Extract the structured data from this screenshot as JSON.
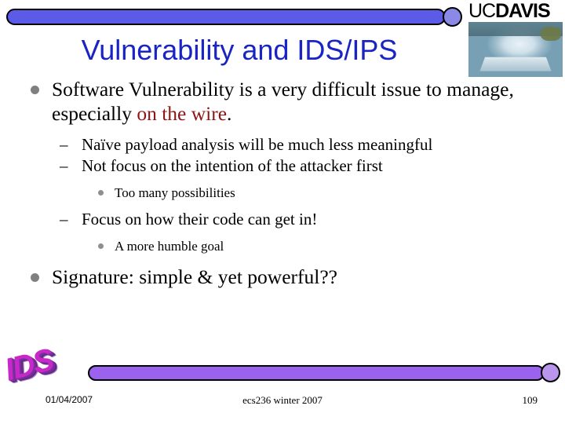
{
  "slide": {
    "title": "Vulnerability and IDS/IPS",
    "bullets": [
      {
        "level": 1,
        "text_before": "Software Vulnerability is a very difficult issue to manage, especially ",
        "highlight": "on the wire",
        "text_after": "."
      },
      {
        "level": 2,
        "marker": "–",
        "text": "Naïve payload analysis will be much less meaningful"
      },
      {
        "level": 2,
        "marker": "–",
        "text": "Not focus on the intention of the attacker first"
      },
      {
        "level": 3,
        "text": "Too many possibilities"
      },
      {
        "level": 2,
        "marker": "–",
        "text": "Focus on how their code can get in!"
      },
      {
        "level": 3,
        "text": "A more humble goal"
      },
      {
        "level": 1,
        "text": "Signature: simple & yet powerful??"
      }
    ]
  },
  "branding": {
    "wordmark_uc": "UC",
    "wordmark_davis": "DAVIS",
    "photo_alt": "egghead-sculpture-photo",
    "ids_logo_text": "IDS"
  },
  "footer": {
    "date": "01/04/2007",
    "course": "ecs236 winter 2007",
    "page_number": "109"
  },
  "colors": {
    "title_blue": "#1a23c4",
    "highlight_red": "#8f1414",
    "top_bar": "#5b5be8",
    "bottom_bar": "#9b63ed",
    "bullet_gray": "#808080",
    "ids_magenta": "#c828c8"
  }
}
